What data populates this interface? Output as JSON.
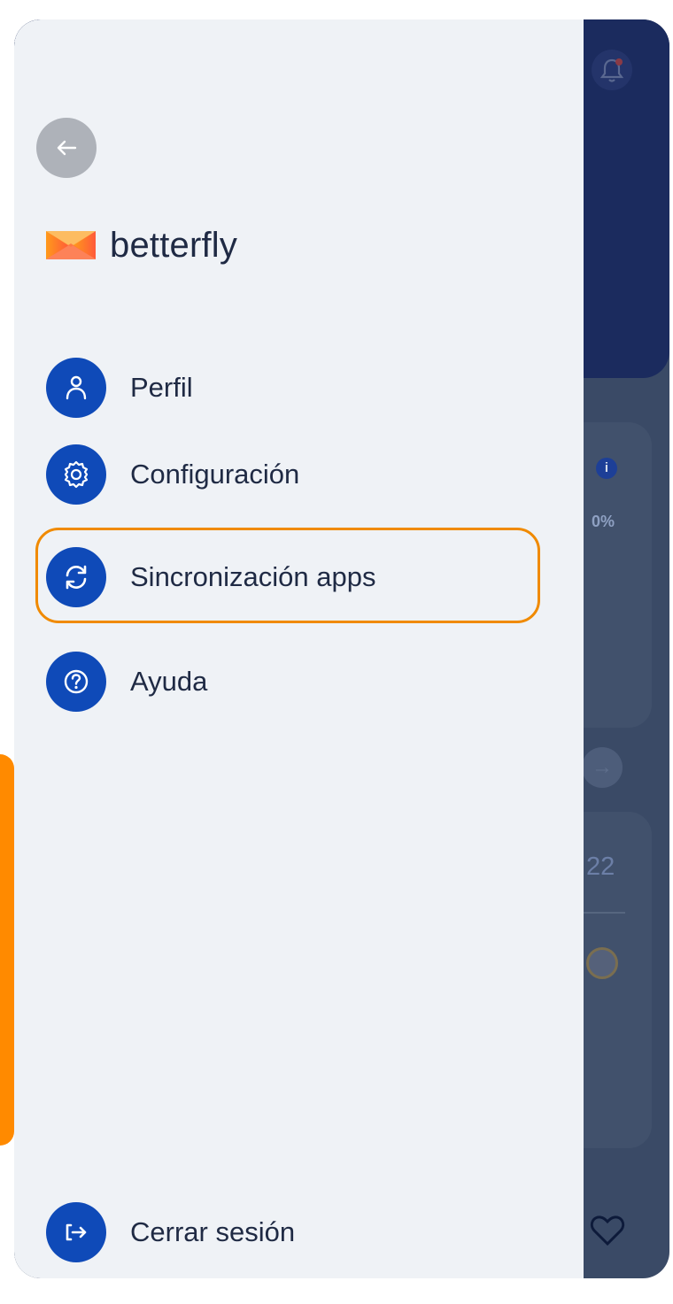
{
  "drawer": {
    "brand": "betterfly",
    "menu": [
      {
        "label": "Perfil",
        "icon": "user-icon"
      },
      {
        "label": "Configuración",
        "icon": "gear-icon"
      },
      {
        "label": "Sincronización apps",
        "icon": "sync-icon",
        "highlighted": true
      },
      {
        "label": "Ayuda",
        "icon": "help-icon"
      }
    ],
    "logout": {
      "label": "Cerrar sesión",
      "icon": "logout-icon"
    }
  },
  "background": {
    "percent": "0%",
    "number": "22"
  },
  "colors": {
    "accent": "#0f4ab8",
    "highlight": "#f08a00",
    "drawer_bg": "#eff2f6",
    "header_bg": "#1b2b5e"
  }
}
